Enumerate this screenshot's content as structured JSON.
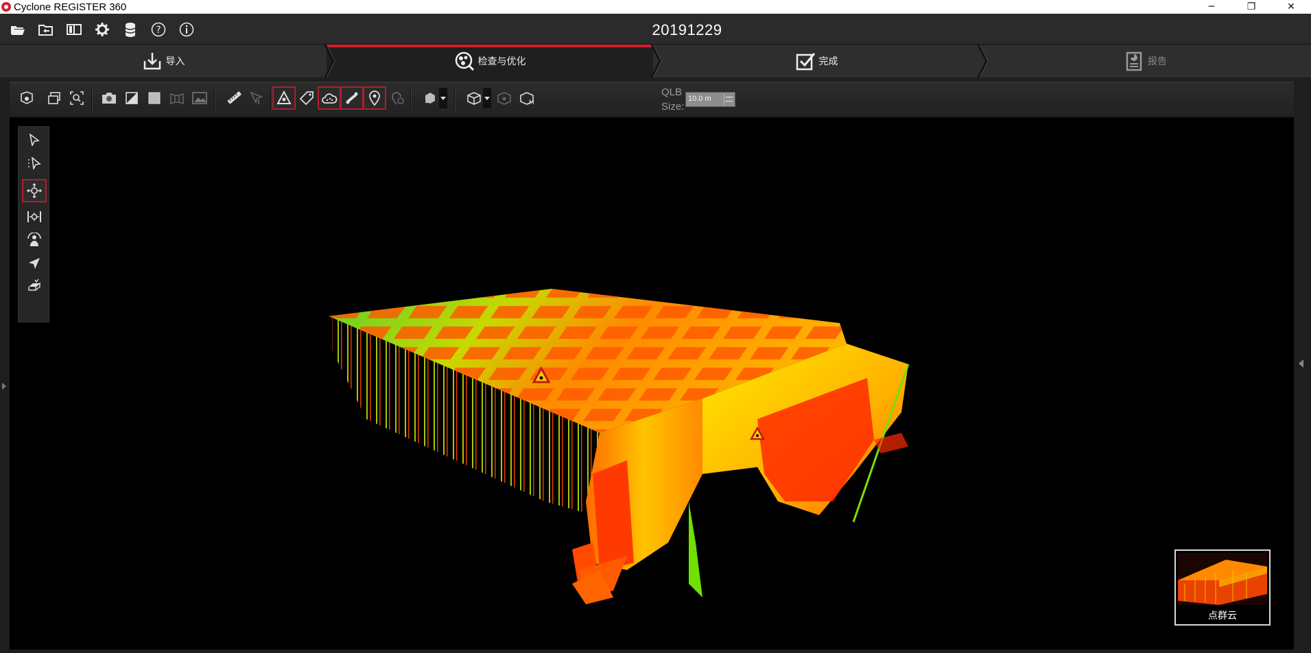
{
  "window": {
    "title": "Cyclone REGISTER 360",
    "minimize_glyph": "─",
    "restore_glyph": "❐",
    "close_glyph": "✕"
  },
  "appbar": {
    "project_title": "20191229",
    "icons": [
      "open-folder-icon",
      "import-folder-icon",
      "panels-icon",
      "gear-icon",
      "database-icon",
      "help-icon",
      "info-icon"
    ]
  },
  "workflow": {
    "tabs": [
      {
        "label": "导入",
        "icon": "import-icon",
        "state": "normal"
      },
      {
        "label": "检查与优化",
        "icon": "review-optimize-icon",
        "state": "active"
      },
      {
        "label": "完成",
        "icon": "finalize-check-icon",
        "state": "normal"
      },
      {
        "label": "报告",
        "icon": "report-icon",
        "state": "disabled"
      }
    ]
  },
  "toolbar": {
    "qlb_label_line1": "QLB",
    "qlb_label_line2": "Size:",
    "qlb_size_value": "10.0 m",
    "toggled_tools": [
      "show-targets",
      "show-clouds",
      "show-links",
      "show-setups"
    ]
  },
  "thumbnail": {
    "label": "点群云"
  },
  "colors": {
    "accent": "#d01f2f",
    "background": "#1e1e1e",
    "viewport": "#000000"
  }
}
